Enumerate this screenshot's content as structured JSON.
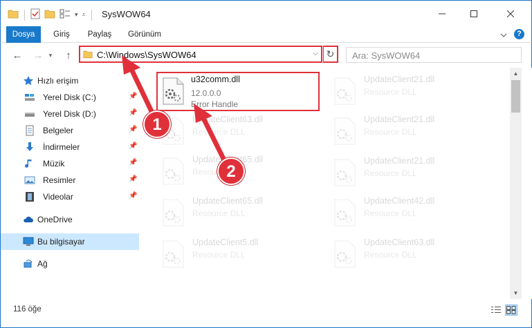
{
  "window": {
    "title": "SysWOW64",
    "controls": {
      "minimize": "—",
      "maximize": "☐",
      "close": "✕"
    }
  },
  "ribbon": {
    "tabs": [
      "Dosya",
      "Giriş",
      "Paylaş",
      "Görünüm"
    ],
    "expand_icon": "chevron-down-icon",
    "help_label": "?"
  },
  "address": {
    "back": "←",
    "forward": "→",
    "recent": "▾",
    "up": "↑",
    "path": "C:\\Windows\\SysWOW64",
    "dropdown": "⌵",
    "refresh": "↻",
    "search_placeholder": "Ara: SysWOW64"
  },
  "nav_pane": {
    "quick_access": "Hızlı erişim",
    "items": [
      {
        "label": "Yerel Disk (C:)",
        "icon": "drive-icon",
        "pinned": true
      },
      {
        "label": "Yerel Disk (D:)",
        "icon": "drive-icon",
        "pinned": true
      },
      {
        "label": "Belgeler",
        "icon": "documents-icon",
        "pinned": true
      },
      {
        "label": "İndirmeler",
        "icon": "downloads-icon",
        "pinned": true
      },
      {
        "label": "Müzik",
        "icon": "music-icon",
        "pinned": true
      },
      {
        "label": "Resimler",
        "icon": "pictures-icon",
        "pinned": true
      },
      {
        "label": "Videolar",
        "icon": "videos-icon",
        "pinned": true
      }
    ],
    "onedrive": "OneDrive",
    "this_pc": "Bu bilgisayar",
    "network": "Ağ"
  },
  "files": {
    "selected": {
      "name": "u32comm.dll",
      "version": "12.0.0.0",
      "description": "Error Handle"
    },
    "left_column": [
      {
        "name": "UpdateClient63.dll",
        "description": "Resource DLL"
      },
      {
        "name": "UpdateClient65.dll",
        "description": "Resource DLL"
      },
      {
        "name": "UpdateClient65.dll",
        "description": "Resource DLL"
      },
      {
        "name": "UpdateClient5.dll",
        "description": "Resource DLL"
      }
    ],
    "right_column": [
      {
        "name": "UpdateClient21.dll",
        "description": "Resource DLL"
      },
      {
        "name": "UpdateClient21.dll",
        "description": "Resource DLL"
      },
      {
        "name": "UpdateClient21.dll",
        "description": "Resource DLL"
      },
      {
        "name": "UpdateClient42.dll",
        "description": "Resource DLL"
      },
      {
        "name": "UpdateClient63.dll",
        "description": "Resource DLL"
      }
    ]
  },
  "status": {
    "item_count": "116 öğe"
  },
  "annotations": {
    "step1": "1",
    "step2": "2",
    "color": "#e0303a"
  },
  "colors": {
    "accent": "#1979ca",
    "highlight": "#e0303a",
    "selection": "#cce8ff"
  }
}
